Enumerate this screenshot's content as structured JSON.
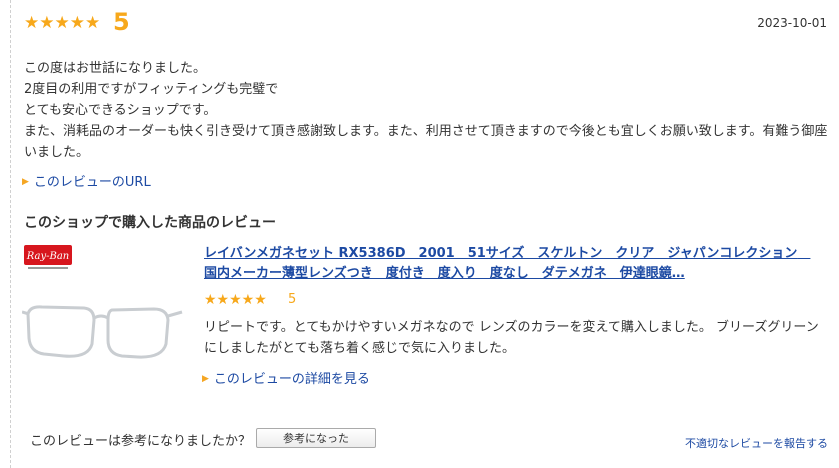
{
  "review": {
    "stars": "★★★★★",
    "rating": "5",
    "date": "2023-10-01",
    "lines": [
      "この度はお世話になりました。",
      "2度目の利用ですがフィッティングも完璧で",
      "とても安心できるショップです。",
      "また、消耗品のオーダーも快く引き受けて頂き感謝致します。また、利用させて頂きますので今後とも宜しくお願い致します。有難う御座いました。"
    ],
    "url_link": "このレビューのURL"
  },
  "shop_section": {
    "title": "このショップで購入した商品のレビュー",
    "logo_text": "Ray-Ban",
    "product_title": "レイバンメガネセット RX5386D　2001　51サイズ　スケルトン　クリア　ジャパンコレクション　国内メーカー薄型レンズつき　度付き　度入り　度なし　ダテメガネ　伊達眼鏡…",
    "stars": "★★★★★",
    "rating": "5",
    "review_text": "リピートです。とてもかけやすいメガネなので レンズのカラーを変えて購入しました。 ブリーズグリーンにしましたがとても落ち着く感じで気に入りました。",
    "detail_link": "このレビューの詳細を見る"
  },
  "footer": {
    "helpful_question": "このレビューは参考になりましたか？",
    "helpful_button": "参考になった",
    "report_link": "不適切なレビューを報告する"
  },
  "colors": {
    "star": "#f7a81b",
    "link": "#1d4aa3",
    "logo_red": "#d7161e"
  }
}
